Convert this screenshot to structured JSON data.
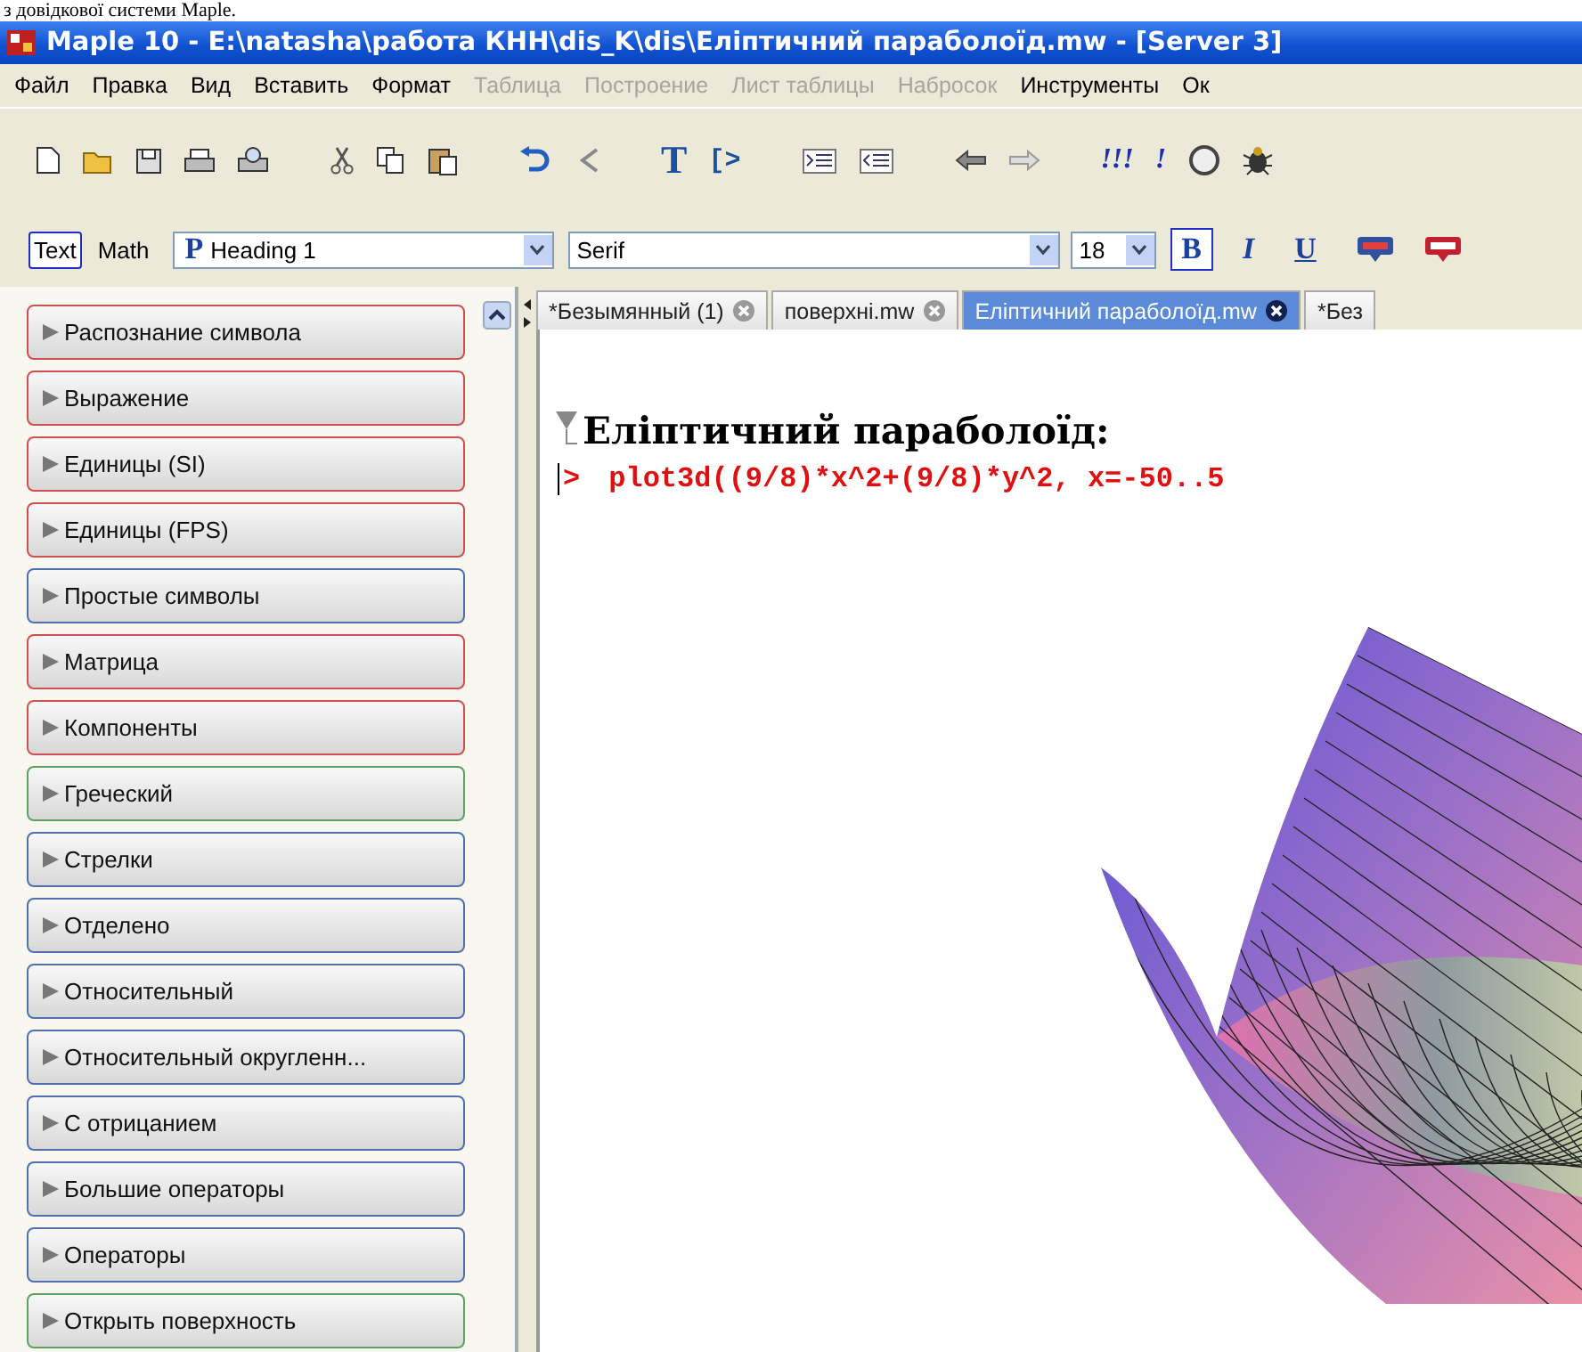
{
  "caption": "з довідкової системи Maple.",
  "window": {
    "title": "Maple 10 - E:\\natasha\\работа КНН\\dis_K\\dis\\Еліптичний параболоїд.mw - [Server 3]"
  },
  "menu": [
    {
      "label": "Файл",
      "disabled": false
    },
    {
      "label": "Правка",
      "disabled": false
    },
    {
      "label": "Вид",
      "disabled": false
    },
    {
      "label": "Вставить",
      "disabled": false
    },
    {
      "label": "Формат",
      "disabled": false
    },
    {
      "label": "Таблица",
      "disabled": true
    },
    {
      "label": "Построение",
      "disabled": true
    },
    {
      "label": "Лист таблицы",
      "disabled": true
    },
    {
      "label": "Набросок",
      "disabled": true
    },
    {
      "label": "Инструменты",
      "disabled": false
    },
    {
      "label": "Ок",
      "disabled": false
    }
  ],
  "toolbar": {
    "glyphs": [
      "T",
      "[>",
      "!!!",
      "!"
    ]
  },
  "format_bar": {
    "modes": [
      {
        "label": "Text",
        "selected": true
      },
      {
        "label": "Math",
        "selected": false
      }
    ],
    "style": {
      "marker": "P",
      "value": "Heading 1"
    },
    "font": {
      "value": "Serif"
    },
    "size": {
      "value": "18"
    },
    "styles": [
      {
        "label": "B",
        "selected": true
      },
      {
        "label": "I",
        "selected": false
      },
      {
        "label": "U",
        "selected": false
      }
    ]
  },
  "palettes": [
    {
      "label": "Распознание символа",
      "color": "#d05050"
    },
    {
      "label": "Выражение",
      "color": "#d05050"
    },
    {
      "label": "Единицы (SI)",
      "color": "#d05050"
    },
    {
      "label": "Единицы (FPS)",
      "color": "#d05050"
    },
    {
      "label": "Простые символы",
      "color": "#5070b0"
    },
    {
      "label": "Матрица",
      "color": "#d05050"
    },
    {
      "label": "Компоненты",
      "color": "#d05050"
    },
    {
      "label": "Греческий",
      "color": "#60a060"
    },
    {
      "label": "Стрелки",
      "color": "#5070b0"
    },
    {
      "label": "Отделено",
      "color": "#5070b0"
    },
    {
      "label": "Относительный",
      "color": "#5070b0"
    },
    {
      "label": "Относительный округленн...",
      "color": "#5070b0"
    },
    {
      "label": "С отрицанием",
      "color": "#5070b0"
    },
    {
      "label": "Большие операторы",
      "color": "#5070b0"
    },
    {
      "label": "Операторы",
      "color": "#5070b0"
    },
    {
      "label": "Открыть поверхность",
      "color": "#60a060"
    }
  ],
  "tabs": [
    {
      "label": "*Безымянный (1)",
      "selected": false
    },
    {
      "label": "поверхні.mw",
      "selected": false
    },
    {
      "label": "Еліптичний параболоїд.mw",
      "selected": true
    },
    {
      "label": "*Без",
      "selected": false
    }
  ],
  "document": {
    "heading": "Еліптичний параболоїд:",
    "prompt": ">",
    "command": "plot3d((9/8)*x^2+(9/8)*y^2, x=-50..5"
  }
}
